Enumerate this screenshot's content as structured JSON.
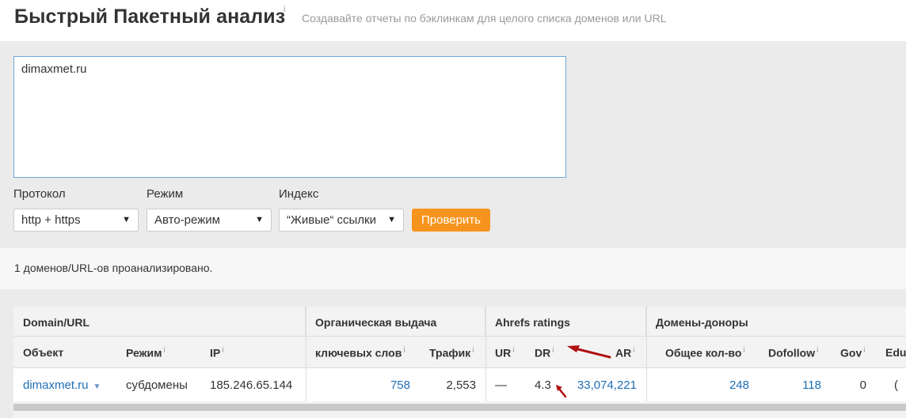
{
  "header": {
    "title": "Быстрый Пакетный анализ",
    "title_info": "i",
    "subtitle": "Создавайте отчеты по бэклинкам для целого списка доменов или URL"
  },
  "form": {
    "targets_value": "dimaxmet.ru",
    "protocol": {
      "label": "Протокол",
      "value": "http + https"
    },
    "mode": {
      "label": "Режим",
      "value": "Авто-режим"
    },
    "index": {
      "label": "Индекс",
      "value": "“Живые“ ссылки"
    },
    "check_button": "Проверить"
  },
  "status": "1 доменов/URL-ов проанализировано.",
  "table": {
    "groups": [
      "Domain/URL",
      "Органическая выдача",
      "Ahrefs ratings",
      "Домены-доноры"
    ],
    "columns": {
      "object": "Объект",
      "mode": "Режим",
      "ip": "IP",
      "keywords": "ключевых слов",
      "traffic": "Трафик",
      "ur": "UR",
      "dr": "DR",
      "ar": "AR",
      "total": "Общее кол-во",
      "dofollow": "Dofollow",
      "gov": "Gov",
      "edu": "Edu"
    },
    "info_mark": "i",
    "row": {
      "object": "dimaxmet.ru",
      "mode": "субдомены",
      "ip": "185.246.65.144",
      "keywords": "758",
      "traffic": "2,553",
      "ur": "—",
      "dr": "4.3",
      "ar": "33,074,221",
      "total": "248",
      "dofollow": "118",
      "gov": "0",
      "edu": "("
    }
  },
  "colors": {
    "accent_orange": "#f7941d",
    "link_blue": "#1e6eb5",
    "annotation_red": "#b01010"
  }
}
